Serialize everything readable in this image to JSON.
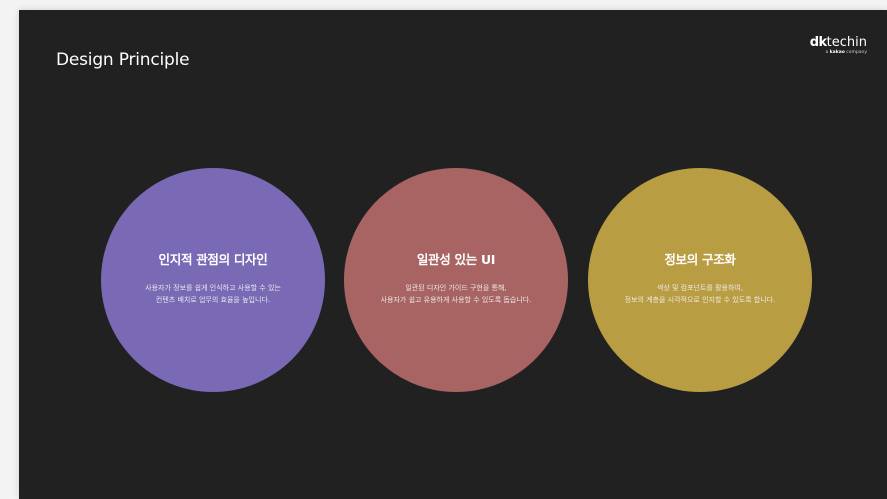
{
  "slide": {
    "title": "Design Principle",
    "logo": {
      "brand_bold": "dk",
      "brand_rest": "techin",
      "sub_prefix": "a ",
      "sub_kakao": "kakao",
      "sub_suffix": " company"
    }
  },
  "principles": [
    {
      "title": "인지적 관점의 디자인",
      "desc_line1": "사용자가 정보를 쉽게 인식하고 사용할 수 있는",
      "desc_line2": "컨텐츠 배치로 업무의 효율을 높입니다.",
      "color": "#7a6ab5"
    },
    {
      "title": "일관성 있는 UI",
      "desc_line1": "일관된 디자인 가이드 구현을 통해,",
      "desc_line2": "사용자가 쉽고 유용하게 사용할 수 있도록 돕습니다.",
      "color": "#a76463"
    },
    {
      "title": "정보의 구조화",
      "desc_line1": "색상 및 컴포넌트를 활용하여,",
      "desc_line2": "정보의 계층을 시각적으로 인지할 수 있도록 합니다.",
      "color": "#b99d43"
    }
  ]
}
